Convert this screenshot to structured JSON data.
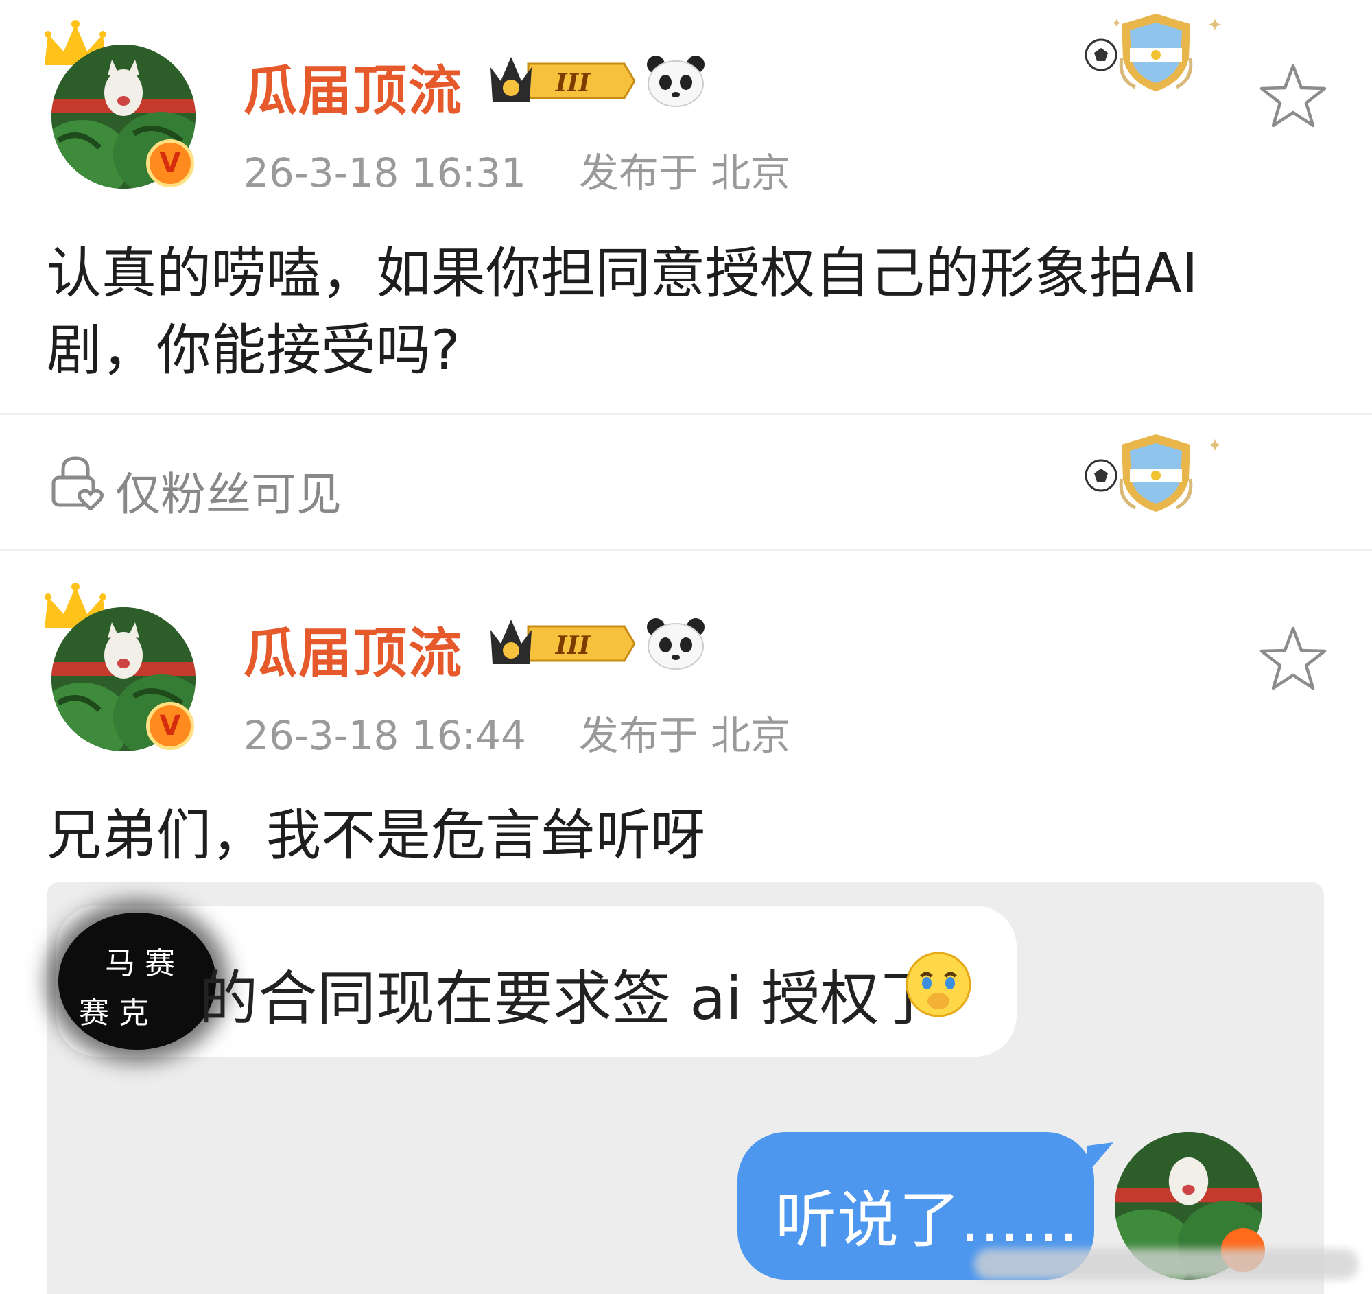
{
  "posts": [
    {
      "username": "瓜届顶流",
      "level_badge": "III",
      "timestamp": "26-3-18 16:31",
      "location": "发布于 北京",
      "text_line1": "认真的唠嗑，如果你担同意授权自己的形象拍AI",
      "text_line2": "剧，你能接受吗?"
    },
    {
      "username": "瓜届顶流",
      "level_badge": "III",
      "timestamp": "26-3-18 16:44",
      "location": "发布于 北京",
      "text_line1": "兄弟们，我不是危言耸听呀"
    }
  ],
  "visibility": {
    "label": "仅粉丝可见"
  },
  "chat": {
    "incoming": {
      "text": "的合同现在要求签 ai 授权了",
      "censor_text_line1": "马 赛",
      "censor_text_line2": "赛 克"
    },
    "outgoing": {
      "text": "听说了......"
    }
  },
  "icons": {
    "favorite": "star-outline-icon",
    "visibility": "lock-heart-icon",
    "badge": "argentina-shield-badge-icon",
    "panda": "panda-icon",
    "crown": "crown-icon",
    "verified": "verified-v-icon",
    "emoji": "crying-emoji-icon"
  },
  "colors": {
    "username": "#e5592b",
    "meta": "#9a9a9a",
    "chat_bg": "#ededed",
    "bubble_blue": "#4d97ee",
    "verified": "#ff8a1d"
  }
}
